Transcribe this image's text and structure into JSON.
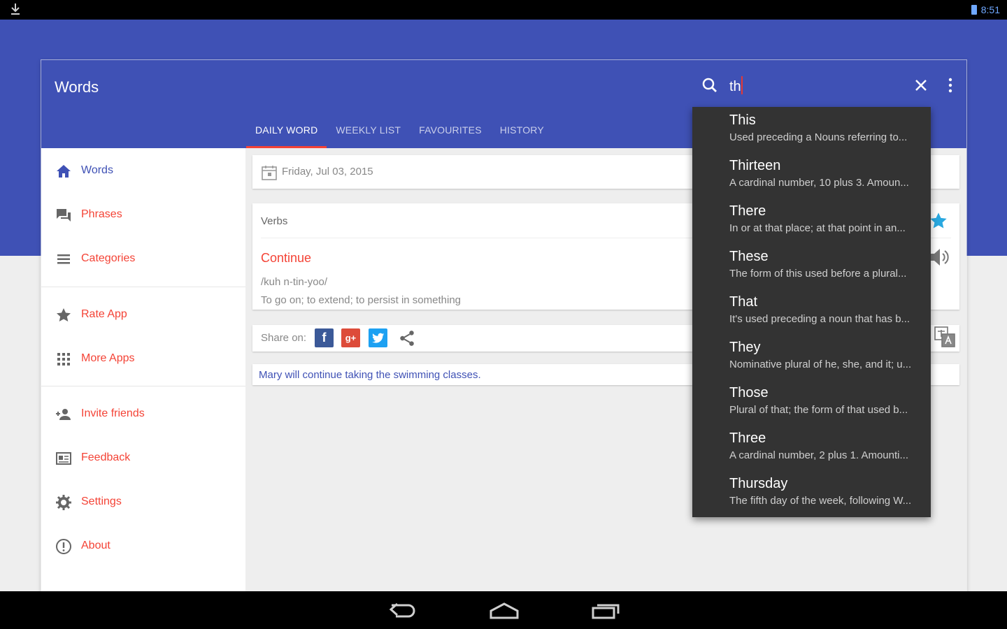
{
  "status_bar": {
    "time": "8:51"
  },
  "app": {
    "title": "Words"
  },
  "search": {
    "value": "th"
  },
  "tabs": [
    {
      "label": "DAILY WORD"
    },
    {
      "label": "WEEKLY LIST"
    },
    {
      "label": "FAVOURITES"
    },
    {
      "label": "HISTORY"
    }
  ],
  "drawer": {
    "items": [
      {
        "label": "Words",
        "icon": "home-icon"
      },
      {
        "label": "Phrases",
        "icon": "chat-icon"
      },
      {
        "label": "Categories",
        "icon": "list-icon"
      },
      {
        "label": "Rate App",
        "icon": "star-icon"
      },
      {
        "label": "More Apps",
        "icon": "apps-grid-icon"
      },
      {
        "label": "Invite friends",
        "icon": "add-person-icon"
      },
      {
        "label": "Feedback",
        "icon": "feedback-icon"
      },
      {
        "label": "Settings",
        "icon": "gear-icon"
      },
      {
        "label": "About",
        "icon": "info-icon"
      }
    ]
  },
  "daily": {
    "date": "Friday, Jul 03, 2015",
    "category": "Verbs",
    "word": "Continue",
    "pronunciation": "/kuh n-tin-yoo/",
    "definition": "To go on; to extend; to persist in something",
    "share_label": "Share on:",
    "example": "Mary will continue taking the swimming classes."
  },
  "suggestions": [
    {
      "title": "This",
      "desc": "Used preceding a Nouns referring to..."
    },
    {
      "title": "Thirteen",
      "desc": "A cardinal number, 10 plus 3. Amoun..."
    },
    {
      "title": "There",
      "desc": "In or at that place; at that point in an..."
    },
    {
      "title": "These",
      "desc": "The form of this used before a plural..."
    },
    {
      "title": "That",
      "desc": "It's used preceding a noun that has b..."
    },
    {
      "title": "They",
      "desc": "Nominative plural of he, she, and it; u..."
    },
    {
      "title": "Those",
      "desc": "Plural of that; the form of that used b..."
    },
    {
      "title": "Three",
      "desc": "A cardinal number, 2 plus 1. Amounti..."
    },
    {
      "title": "Thursday",
      "desc": "The fifth day of the week, following W..."
    }
  ],
  "colors": {
    "primary": "#3f51b5",
    "accent": "#f44336",
    "suggestion_bg": "#333333"
  }
}
